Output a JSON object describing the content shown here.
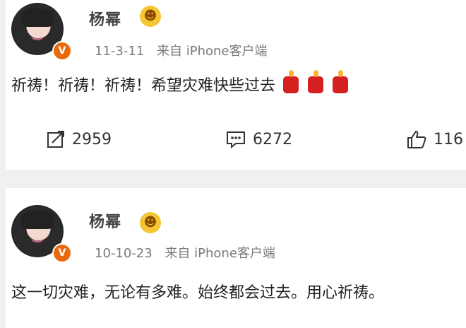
{
  "posts": [
    {
      "username": "杨幂",
      "date": "11-3-11",
      "source": "来自 iPhone客户端",
      "text": "祈祷！祈祷！祈祷！希望灾难快些过去",
      "reposts": "2959",
      "comments": "6272",
      "likes": "116",
      "verify_badge": "V",
      "vip_badge": "☻",
      "accent_color": "#e9690d"
    },
    {
      "username": "杨幂",
      "date": "10-10-23",
      "source": "来自 iPhone客户端",
      "text": "这一切灾难，无论有多难。始终都会过去。用心祈祷。",
      "verify_badge": "V",
      "vip_badge": "☻"
    }
  ],
  "icons": {
    "repost": "repost-icon",
    "comment": "comment-icon",
    "like": "thumbs-up-icon",
    "verify": "verified-badge-icon",
    "vip": "vip-emoji-icon",
    "candle": "candle-emoji-icon"
  }
}
